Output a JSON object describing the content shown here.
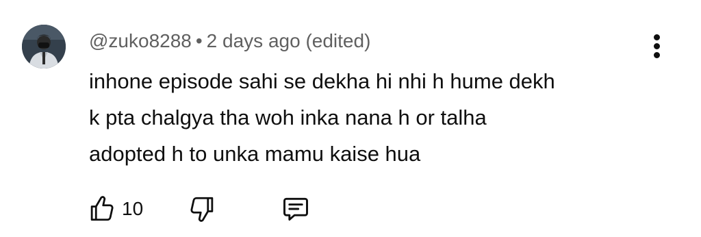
{
  "comment": {
    "author": "@zuko8288",
    "separator": "•",
    "timestamp": "2 days ago",
    "edited_label": "(edited)",
    "text_lines": [
      "inhone episode sahi se dekha hi nhi h hume dekh",
      "k pta chalgya tha woh inka nana h or talha",
      "adopted h to unka mamu kaise hua"
    ],
    "likes": "10",
    "avatar_icon": "avatar-icon",
    "more_icon": "more-vert-icon",
    "like_icon": "thumbs-up-icon",
    "dislike_icon": "thumbs-down-icon",
    "reply_icon": "comment-reply-icon"
  },
  "colors": {
    "text": "#0f0f0f",
    "meta": "#606060",
    "background": "#ffffff"
  }
}
